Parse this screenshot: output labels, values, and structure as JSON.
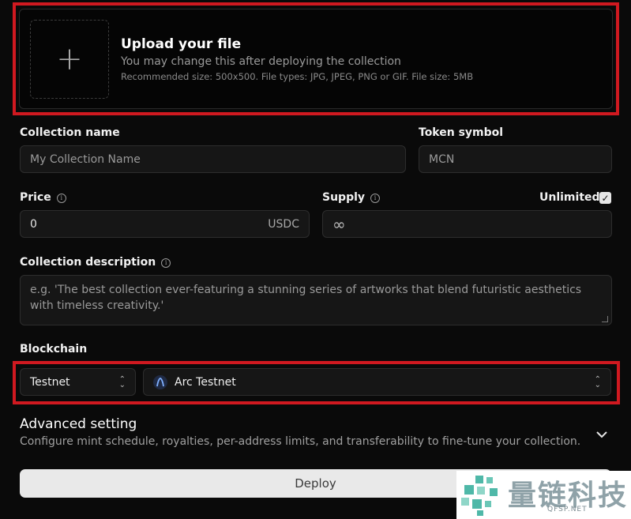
{
  "upload": {
    "plus": "+",
    "title": "Upload your file",
    "subtitle": "You may change this after deploying the collection",
    "hint": "Recommended size: 500x500. File types: JPG, JPEG, PNG or GIF. File size: 5MB"
  },
  "collection_name": {
    "label": "Collection name",
    "placeholder": "My Collection Name"
  },
  "token_symbol": {
    "label": "Token symbol",
    "placeholder": "MCN"
  },
  "price": {
    "label": "Price",
    "value": "0",
    "currency": "USDC"
  },
  "supply": {
    "label": "Supply",
    "value": "∞",
    "unlimited_label": "Unlimited",
    "unlimited_checked": true
  },
  "description": {
    "label": "Collection description",
    "placeholder": "e.g. 'The best collection ever-featuring a stunning series of artworks that blend futuristic aesthetics with timeless creativity.'"
  },
  "blockchain": {
    "label": "Blockchain",
    "network_type": "Testnet",
    "network": "Arc Testnet"
  },
  "advanced": {
    "title": "Advanced setting",
    "description": "Configure mint schedule, royalties, per-address limits, and transferability to fine-tune your collection."
  },
  "deploy_label": "Deploy",
  "watermark": {
    "text": "量链科技",
    "sub": "QFSP.NET"
  },
  "colors": {
    "highlight": "#d01920",
    "background": "#0a0a0a",
    "field": "#161616"
  }
}
